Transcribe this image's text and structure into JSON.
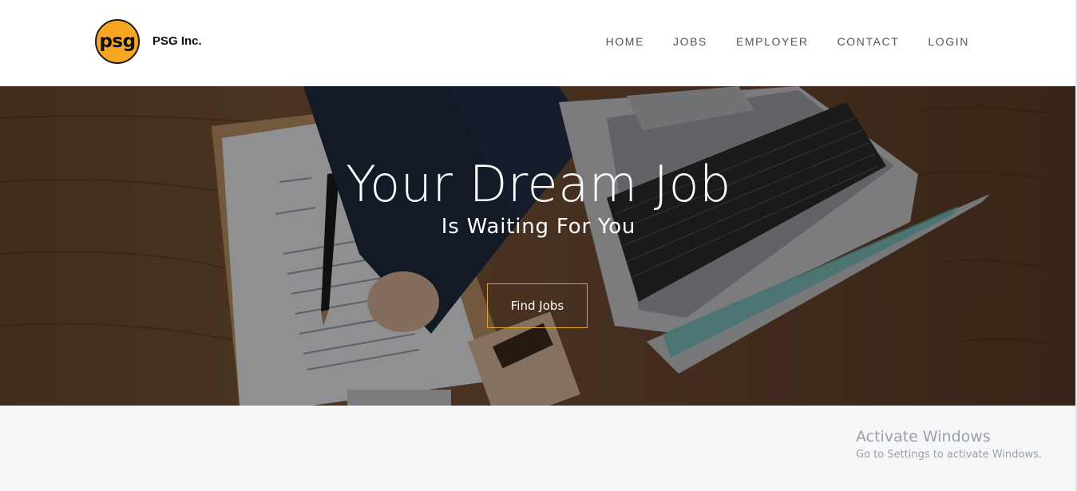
{
  "header": {
    "logo_text": "psg",
    "brand_name": "PSG Inc.",
    "nav": [
      {
        "label": "HOME"
      },
      {
        "label": "JOBS"
      },
      {
        "label": "EMPLOYER"
      },
      {
        "label": "CONTACT"
      },
      {
        "label": "LOGIN"
      }
    ]
  },
  "hero": {
    "title": "Your Dream Job",
    "subtitle": "Is Waiting For You",
    "cta_label": "Find Jobs"
  },
  "watermark": {
    "line1": "Activate Windows",
    "line2": "Go to Settings to activate Windows."
  },
  "colors": {
    "logo_bg": "#f6a623",
    "cta_border": "#e0a826",
    "nav_text": "#555555"
  }
}
